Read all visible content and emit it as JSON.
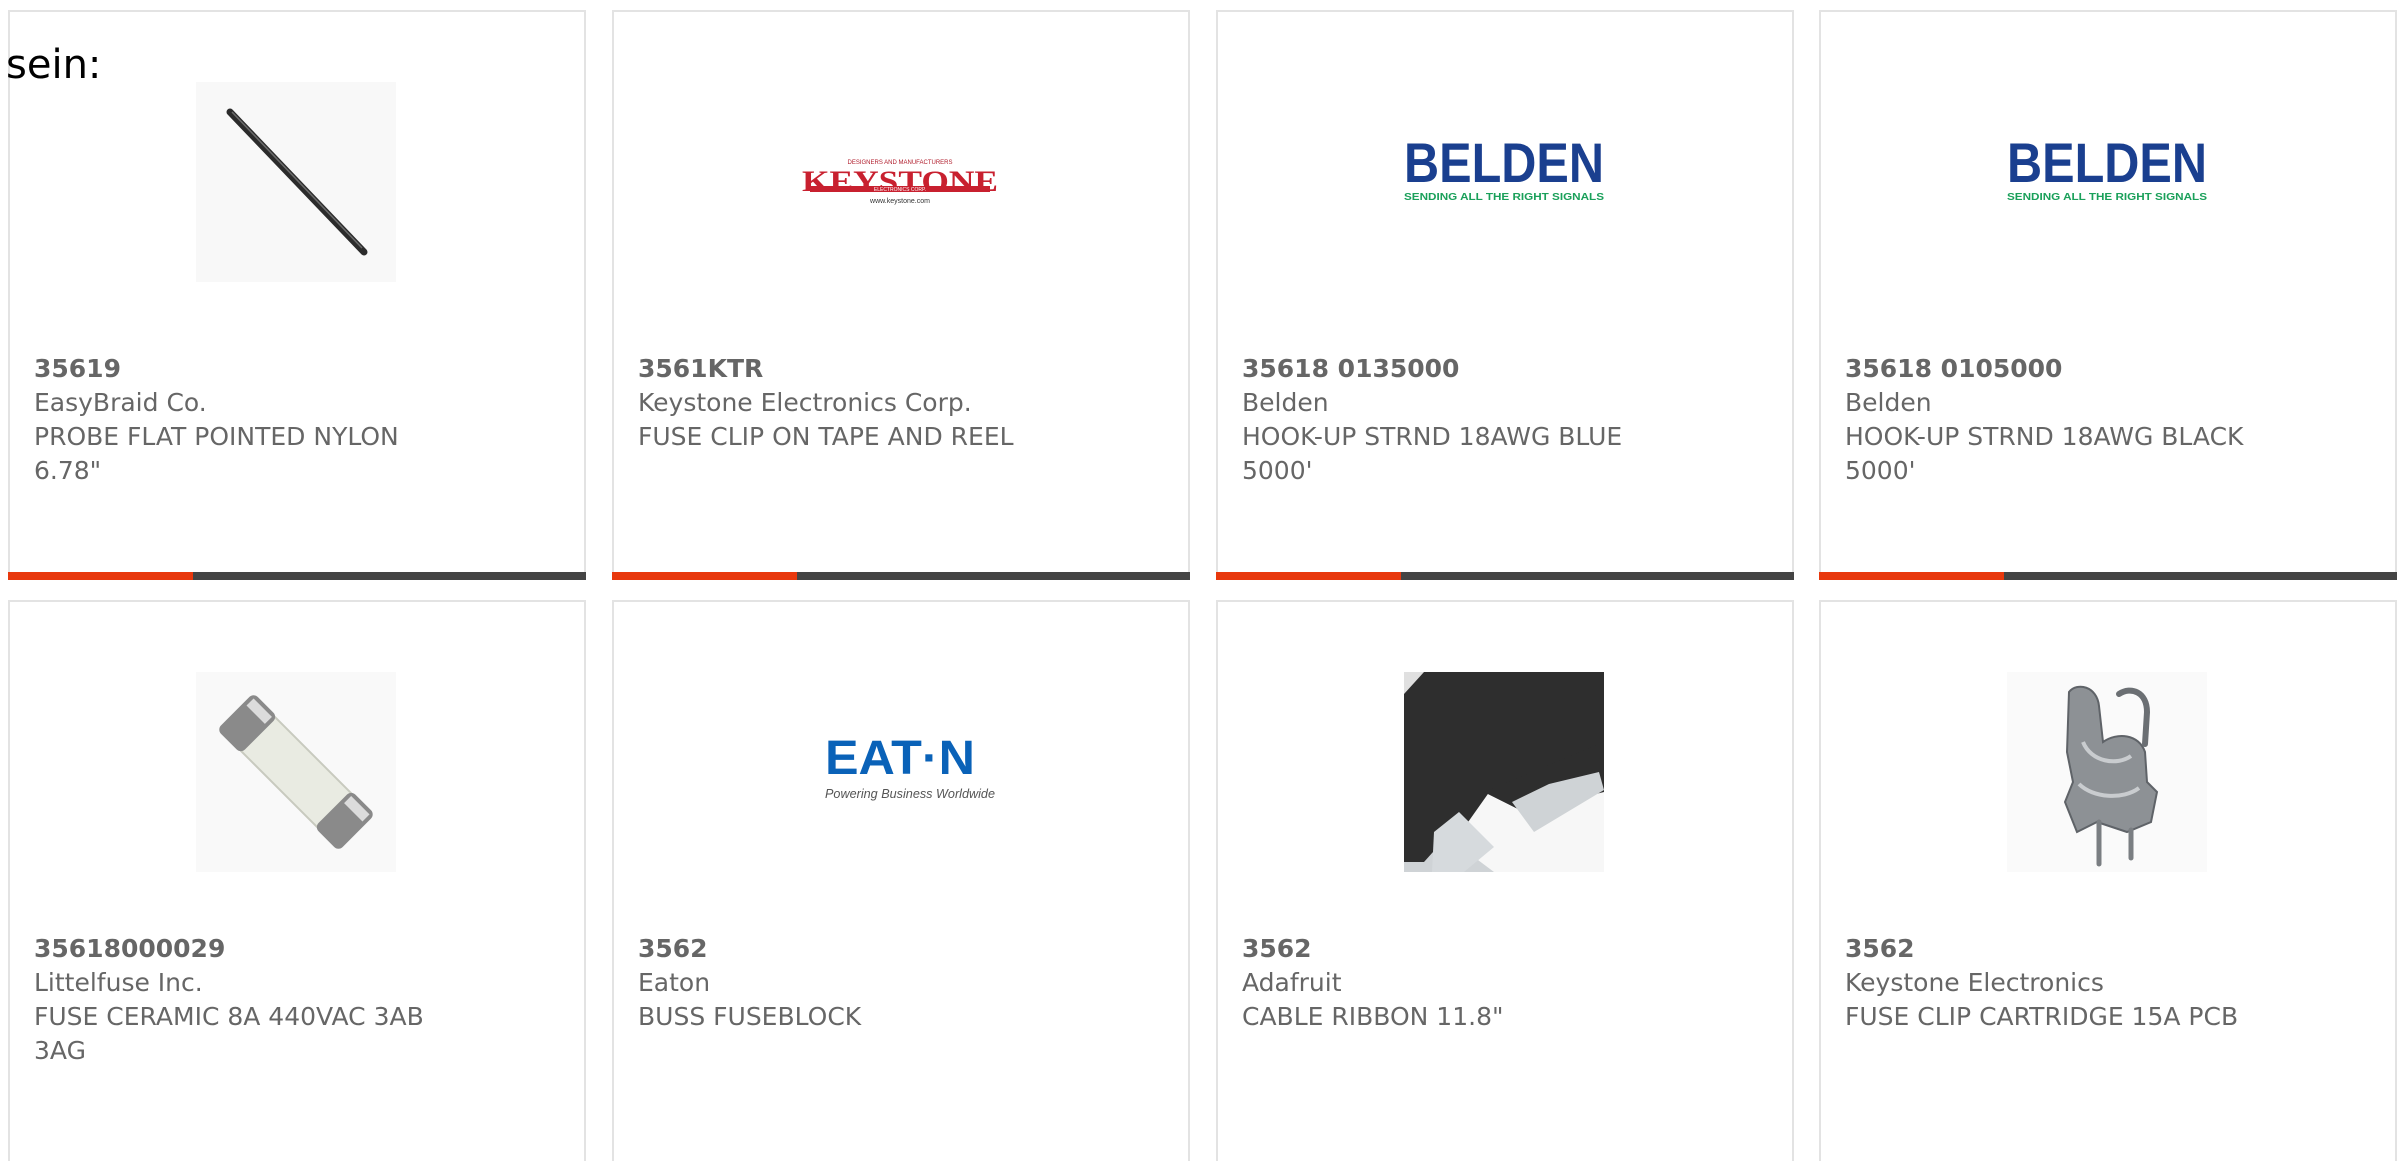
{
  "intro_text": "sein:",
  "colors": {
    "accent": "#e8380d",
    "bar_track": "#444444",
    "text": "#666666",
    "border": "#e3e3e3"
  },
  "products": [
    {
      "part_number": "35619",
      "manufacturer": "EasyBraid Co.",
      "description": "PROBE FLAT POINTED NYLON 6.78\"",
      "image": "probe-image",
      "progress_fraction": 0.32
    },
    {
      "part_number": "3561KTR",
      "manufacturer": "Keystone Electronics Corp.",
      "description": "FUSE CLIP ON TAPE AND REEL",
      "image": "keystone-logo",
      "logo_text": "KEYSTONE",
      "logo_top": "DESIGNERS AND MANUFACTURERS",
      "logo_sub": "ELECTRONICS CORP.",
      "logo_url": "www.keystone.com",
      "progress_fraction": 0.32
    },
    {
      "part_number": "35618 0135000",
      "manufacturer": "Belden",
      "description": "HOOK-UP STRND 18AWG BLUE 5000'",
      "image": "belden-logo",
      "logo_text": "BELDEN",
      "logo_sub": "SENDING ALL THE RIGHT SIGNALS",
      "progress_fraction": 0.32
    },
    {
      "part_number": "35618 0105000",
      "manufacturer": "Belden",
      "description": "HOOK-UP STRND 18AWG BLACK 5000'",
      "image": "belden-logo",
      "logo_text": "BELDEN",
      "logo_sub": "SENDING ALL THE RIGHT SIGNALS",
      "progress_fraction": 0.32
    },
    {
      "part_number": "35618000029",
      "manufacturer": "Littelfuse Inc.",
      "description": "FUSE CERAMIC 8A 440VAC 3AB 3AG",
      "image": "ceramic-fuse-image"
    },
    {
      "part_number": "3562",
      "manufacturer": "Eaton",
      "description": "BUSS FUSEBLOCK",
      "image": "eaton-logo",
      "logo_text": "EAT·N",
      "logo_sub": "Powering Business Worldwide"
    },
    {
      "part_number": "3562",
      "manufacturer": "Adafruit",
      "description": "CABLE RIBBON 11.8\"",
      "image": "ribbon-cable-image"
    },
    {
      "part_number": "3562",
      "manufacturer": "Keystone Electronics",
      "description": "FUSE CLIP CARTRIDGE 15A PCB",
      "image": "fuse-clip-image"
    }
  ]
}
